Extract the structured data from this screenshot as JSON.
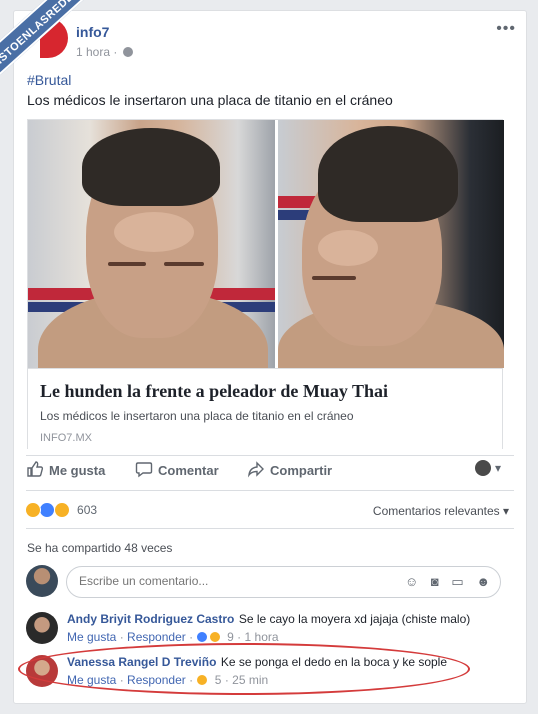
{
  "watermark": "VISTOENLASREDES.COM",
  "post": {
    "page_name": "info7",
    "time": "1 hora",
    "more_label": "•••",
    "hashtag": "#Brutal",
    "text": "Los médicos le insertaron una placa de titanio en el cráneo"
  },
  "link": {
    "title": "Le hunden la frente a peleador de Muay Thai",
    "description": "Los médicos le insertaron una placa de titanio en el cráneo",
    "domain": "INFO7.MX"
  },
  "actions": {
    "like": "Me gusta",
    "comment": "Comentar",
    "share": "Compartir",
    "share_as_arrow": "▾"
  },
  "reactions": {
    "count": "603",
    "sort_label": "Comentarios relevantes ▾"
  },
  "shared": "Se ha compartido 48 veces",
  "comment_box": {
    "placeholder": "Escribe un comentario..."
  },
  "comments": [
    {
      "author": "Andy Briyit Rodriguez Castro",
      "text": "Se le cayo la moyera xd jajaja (chiste malo)",
      "like": "Me gusta",
      "reply": "Responder",
      "reaction_count": "9",
      "time": "1 hora"
    },
    {
      "author": "Vanessa Rangel D Treviño",
      "text": "Ke se ponga el dedo en la boca y ke sople",
      "like": "Me gusta",
      "reply": "Responder",
      "reaction_count": "5",
      "time": "25 min"
    }
  ],
  "colors": {
    "link_blue": "#365899",
    "highlight_red": "#d43b3b",
    "like_blue": "#4080ff"
  }
}
